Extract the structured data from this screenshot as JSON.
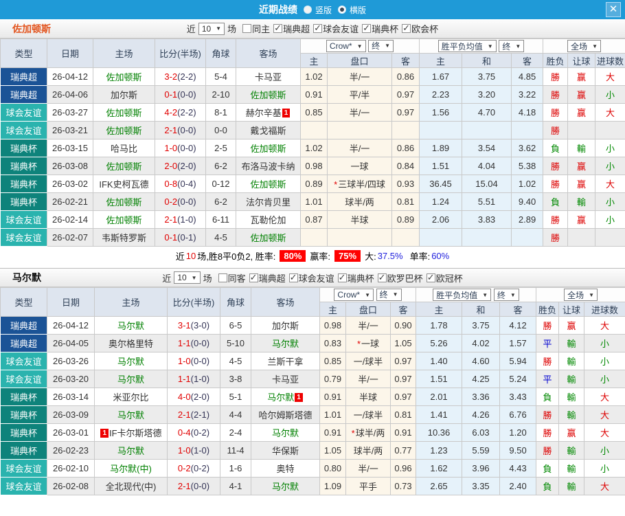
{
  "titlebar": {
    "title": "近期战绩",
    "radio_vertical": "竖版",
    "radio_horizontal": "横版",
    "close_label": "✕"
  },
  "table_header": {
    "type": "类型",
    "date": "日期",
    "home": "主场",
    "score": "比分(半场)",
    "corner": "角球",
    "away": "客场",
    "odds_home": "主",
    "odds_handicap": "盘口",
    "odds_away": "客",
    "mean_home": "主",
    "mean_draw": "和",
    "mean_away": "客",
    "result_wdl": "胜负",
    "result_handicap": "让球",
    "result_goals": "进球数",
    "dd_crow": "Crow*",
    "dd_final1": "终",
    "dd_mean": "胜平负均值",
    "dd_final2": "终",
    "dd_full": "全场"
  },
  "colors": {
    "league_super": "#1b5396",
    "league_friendly": "#2ab3ae",
    "league_cup": "#0e837b",
    "titlebar_blue": "#1f9ad7",
    "accent_red": "#e10000",
    "accent_green": "#008800",
    "accent_blue": "#0000d0"
  },
  "sections": [
    {
      "team": "佐加顿斯",
      "filter": {
        "near_label": "近",
        "games_value": "10",
        "games_label": "场",
        "checkboxes": [
          {
            "label": "同主",
            "checked": false
          },
          {
            "label": "瑞典超",
            "checked": true
          },
          {
            "label": "球会友谊",
            "checked": true
          },
          {
            "label": "瑞典杯",
            "checked": true
          },
          {
            "label": "欧会杯",
            "checked": true
          }
        ]
      },
      "rows": [
        {
          "type": "瑞典超",
          "type_color": "#1b5396",
          "date": "26-04-12",
          "home": "佐加顿斯",
          "home_green": true,
          "home_badge": "",
          "home_badge_pos": "",
          "score_full": "3-2",
          "score_half": "(2-2)",
          "corner": "5-4",
          "away": "卡马亚",
          "away_green": false,
          "away_badge": "",
          "odds_home": "1.02",
          "handicap": "半/一",
          "handicap_star": false,
          "odds_away": "0.86",
          "mean_home": "1.67",
          "mean_draw": "3.75",
          "mean_away": "4.85",
          "result_wdl": "勝",
          "result_wdl_color": "red",
          "result_handicap": "赢",
          "result_handicap_color": "red",
          "result_goals": "大",
          "result_goals_color": "red"
        },
        {
          "type": "瑞典超",
          "type_color": "#1b5396",
          "date": "26-04-06",
          "home": "加尔斯",
          "home_green": false,
          "home_badge": "",
          "home_badge_pos": "",
          "score_full": "0-1",
          "score_half": "(0-0)",
          "corner": "2-10",
          "away": "佐加顿斯",
          "away_green": true,
          "away_badge": "",
          "odds_home": "0.91",
          "handicap": "平/半",
          "handicap_star": false,
          "odds_away": "0.97",
          "mean_home": "2.23",
          "mean_draw": "3.20",
          "mean_away": "3.22",
          "result_wdl": "勝",
          "result_wdl_color": "red",
          "result_handicap": "赢",
          "result_handicap_color": "red",
          "result_goals": "小",
          "result_goals_color": "green"
        },
        {
          "type": "球会友谊",
          "type_color": "#2ab3ae",
          "date": "26-03-27",
          "home": "佐加顿斯",
          "home_green": true,
          "home_badge": "",
          "home_badge_pos": "",
          "score_full": "4-2",
          "score_half": "(2-2)",
          "corner": "8-1",
          "away": "赫尔辛基",
          "away_green": false,
          "away_badge": "1",
          "odds_home": "0.85",
          "handicap": "半/一",
          "handicap_star": false,
          "odds_away": "0.97",
          "mean_home": "1.56",
          "mean_draw": "4.70",
          "mean_away": "4.18",
          "result_wdl": "勝",
          "result_wdl_color": "red",
          "result_handicap": "赢",
          "result_handicap_color": "red",
          "result_goals": "大",
          "result_goals_color": "red"
        },
        {
          "type": "球会友谊",
          "type_color": "#2ab3ae",
          "date": "26-03-21",
          "home": "佐加顿斯",
          "home_green": true,
          "home_badge": "",
          "home_badge_pos": "",
          "score_full": "2-1",
          "score_half": "(0-0)",
          "corner": "0-0",
          "away": "戴戈福斯",
          "away_green": false,
          "away_badge": "",
          "odds_home": "",
          "handicap": "",
          "handicap_star": false,
          "odds_away": "",
          "mean_home": "",
          "mean_draw": "",
          "mean_away": "",
          "result_wdl": "勝",
          "result_wdl_color": "red",
          "result_handicap": "",
          "result_handicap_color": "red",
          "result_goals": "",
          "result_goals_color": "red"
        },
        {
          "type": "瑞典杯",
          "type_color": "#0e837b",
          "date": "26-03-15",
          "home": "哈马比",
          "home_green": false,
          "home_badge": "",
          "home_badge_pos": "",
          "score_full": "1-0",
          "score_half": "(0-0)",
          "corner": "2-5",
          "away": "佐加顿斯",
          "away_green": true,
          "away_badge": "",
          "odds_home": "1.02",
          "handicap": "半/一",
          "handicap_star": false,
          "odds_away": "0.86",
          "mean_home": "1.89",
          "mean_draw": "3.54",
          "mean_away": "3.62",
          "result_wdl": "負",
          "result_wdl_color": "green",
          "result_handicap": "輸",
          "result_handicap_color": "green",
          "result_goals": "小",
          "result_goals_color": "green"
        },
        {
          "type": "瑞典杯",
          "type_color": "#0e837b",
          "date": "26-03-08",
          "home": "佐加顿斯",
          "home_green": true,
          "home_badge": "",
          "home_badge_pos": "",
          "score_full": "2-0",
          "score_half": "(2-0)",
          "corner": "6-2",
          "away": "布洛马波卡纳",
          "away_green": false,
          "away_badge": "",
          "odds_home": "0.98",
          "handicap": "一球",
          "handicap_star": false,
          "odds_away": "0.84",
          "mean_home": "1.51",
          "mean_draw": "4.04",
          "mean_away": "5.38",
          "result_wdl": "勝",
          "result_wdl_color": "red",
          "result_handicap": "赢",
          "result_handicap_color": "red",
          "result_goals": "小",
          "result_goals_color": "green"
        },
        {
          "type": "瑞典杯",
          "type_color": "#0e837b",
          "date": "26-03-02",
          "home": "IFK史柯瓦德",
          "home_green": false,
          "home_badge": "",
          "home_badge_pos": "",
          "score_full": "0-8",
          "score_half": "(0-4)",
          "corner": "0-12",
          "away": "佐加顿斯",
          "away_green": true,
          "away_badge": "",
          "odds_home": "0.89",
          "handicap": "三球半/四球",
          "handicap_star": true,
          "odds_away": "0.93",
          "mean_home": "36.45",
          "mean_draw": "15.04",
          "mean_away": "1.02",
          "result_wdl": "勝",
          "result_wdl_color": "red",
          "result_handicap": "赢",
          "result_handicap_color": "red",
          "result_goals": "大",
          "result_goals_color": "red"
        },
        {
          "type": "瑞典杯",
          "type_color": "#0e837b",
          "date": "26-02-21",
          "home": "佐加顿斯",
          "home_green": true,
          "home_badge": "",
          "home_badge_pos": "",
          "score_full": "0-2",
          "score_half": "(0-0)",
          "corner": "6-2",
          "away": "法尔肯贝里",
          "away_green": false,
          "away_badge": "",
          "odds_home": "1.01",
          "handicap": "球半/两",
          "handicap_star": false,
          "odds_away": "0.81",
          "mean_home": "1.24",
          "mean_draw": "5.51",
          "mean_away": "9.40",
          "result_wdl": "負",
          "result_wdl_color": "green",
          "result_handicap": "輸",
          "result_handicap_color": "green",
          "result_goals": "小",
          "result_goals_color": "green"
        },
        {
          "type": "球会友谊",
          "type_color": "#2ab3ae",
          "date": "26-02-14",
          "home": "佐加顿斯",
          "home_green": true,
          "home_badge": "",
          "home_badge_pos": "",
          "score_full": "2-1",
          "score_half": "(1-0)",
          "corner": "6-11",
          "away": "瓦勒伦加",
          "away_green": false,
          "away_badge": "",
          "odds_home": "0.87",
          "handicap": "半球",
          "handicap_star": false,
          "odds_away": "0.89",
          "mean_home": "2.06",
          "mean_draw": "3.83",
          "mean_away": "2.89",
          "result_wdl": "勝",
          "result_wdl_color": "red",
          "result_handicap": "赢",
          "result_handicap_color": "red",
          "result_goals": "小",
          "result_goals_color": "green"
        },
        {
          "type": "球会友谊",
          "type_color": "#2ab3ae",
          "date": "26-02-07",
          "home": "韦斯特罗斯",
          "home_green": false,
          "home_badge": "",
          "home_badge_pos": "",
          "score_full": "0-1",
          "score_half": "(0-1)",
          "corner": "4-5",
          "away": "佐加顿斯",
          "away_green": true,
          "away_badge": "",
          "odds_home": "",
          "handicap": "",
          "handicap_star": false,
          "odds_away": "",
          "mean_home": "",
          "mean_draw": "",
          "mean_away": "",
          "result_wdl": "勝",
          "result_wdl_color": "red",
          "result_handicap": "",
          "result_handicap_color": "red",
          "result_goals": "",
          "result_goals_color": "red"
        }
      ],
      "summary": {
        "part1": "近",
        "count": "10",
        "part2": "场,胜8平0负2, 胜率:",
        "win_rate": "80%",
        "label_win2": "赢率:",
        "win_rate2": "75%",
        "label_big": "大:",
        "big_rate": "37.5%",
        "label_single": "单率:",
        "single_rate": "60%"
      }
    },
    {
      "team": "马尔默",
      "filter": {
        "near_label": "近",
        "games_value": "10",
        "games_label": "场",
        "checkboxes": [
          {
            "label": "同客",
            "checked": false
          },
          {
            "label": "瑞典超",
            "checked": true
          },
          {
            "label": "球会友谊",
            "checked": true
          },
          {
            "label": "瑞典杯",
            "checked": true
          },
          {
            "label": "欧罗巴杯",
            "checked": true
          },
          {
            "label": "欧冠杯",
            "checked": true
          }
        ]
      },
      "rows": [
        {
          "type": "瑞典超",
          "type_color": "#1b5396",
          "date": "26-04-12",
          "home": "马尔默",
          "home_green": true,
          "home_badge": "",
          "home_badge_pos": "",
          "score_full": "3-1",
          "score_half": "(3-0)",
          "corner": "6-5",
          "away": "加尔斯",
          "away_green": false,
          "away_badge": "",
          "odds_home": "0.98",
          "handicap": "半/一",
          "handicap_star": false,
          "odds_away": "0.90",
          "mean_home": "1.78",
          "mean_draw": "3.75",
          "mean_away": "4.12",
          "result_wdl": "勝",
          "result_wdl_color": "red",
          "result_handicap": "赢",
          "result_handicap_color": "red",
          "result_goals": "大",
          "result_goals_color": "red"
        },
        {
          "type": "瑞典超",
          "type_color": "#1b5396",
          "date": "26-04-05",
          "home": "奥尔格里特",
          "home_green": false,
          "home_badge": "",
          "home_badge_pos": "",
          "score_full": "1-1",
          "score_half": "(0-0)",
          "corner": "5-10",
          "away": "马尔默",
          "away_green": true,
          "away_badge": "",
          "odds_home": "0.83",
          "handicap": "一球",
          "handicap_star": true,
          "odds_away": "1.05",
          "mean_home": "5.26",
          "mean_draw": "4.02",
          "mean_away": "1.57",
          "result_wdl": "平",
          "result_wdl_color": "blue",
          "result_handicap": "輸",
          "result_handicap_color": "green",
          "result_goals": "小",
          "result_goals_color": "green"
        },
        {
          "type": "球会友谊",
          "type_color": "#2ab3ae",
          "date": "26-03-26",
          "home": "马尔默",
          "home_green": true,
          "home_badge": "",
          "home_badge_pos": "",
          "score_full": "1-0",
          "score_half": "(0-0)",
          "corner": "4-5",
          "away": "兰斯干拿",
          "away_green": false,
          "away_badge": "",
          "odds_home": "0.85",
          "handicap": "一/球半",
          "handicap_star": false,
          "odds_away": "0.97",
          "mean_home": "1.40",
          "mean_draw": "4.60",
          "mean_away": "5.94",
          "result_wdl": "勝",
          "result_wdl_color": "red",
          "result_handicap": "輸",
          "result_handicap_color": "green",
          "result_goals": "小",
          "result_goals_color": "green"
        },
        {
          "type": "球会友谊",
          "type_color": "#2ab3ae",
          "date": "26-03-20",
          "home": "马尔默",
          "home_green": true,
          "home_badge": "",
          "home_badge_pos": "",
          "score_full": "1-1",
          "score_half": "(1-0)",
          "corner": "3-8",
          "away": "卡马亚",
          "away_green": false,
          "away_badge": "",
          "odds_home": "0.79",
          "handicap": "半/一",
          "handicap_star": false,
          "odds_away": "0.97",
          "mean_home": "1.51",
          "mean_draw": "4.25",
          "mean_away": "5.24",
          "result_wdl": "平",
          "result_wdl_color": "blue",
          "result_handicap": "輸",
          "result_handicap_color": "green",
          "result_goals": "小",
          "result_goals_color": "green"
        },
        {
          "type": "瑞典杯",
          "type_color": "#0e837b",
          "date": "26-03-14",
          "home": "米亚尔比",
          "home_green": false,
          "home_badge": "",
          "home_badge_pos": "",
          "score_full": "4-0",
          "score_half": "(2-0)",
          "corner": "5-1",
          "away": "马尔默",
          "away_green": true,
          "away_badge": "1",
          "odds_home": "0.91",
          "handicap": "半球",
          "handicap_star": false,
          "odds_away": "0.97",
          "mean_home": "2.01",
          "mean_draw": "3.36",
          "mean_away": "3.43",
          "result_wdl": "負",
          "result_wdl_color": "green",
          "result_handicap": "輸",
          "result_handicap_color": "green",
          "result_goals": "大",
          "result_goals_color": "red"
        },
        {
          "type": "瑞典杯",
          "type_color": "#0e837b",
          "date": "26-03-09",
          "home": "马尔默",
          "home_green": true,
          "home_badge": "",
          "home_badge_pos": "",
          "score_full": "2-1",
          "score_half": "(2-1)",
          "corner": "4-4",
          "away": "哈尔姆斯塔德",
          "away_green": false,
          "away_badge": "",
          "odds_home": "1.01",
          "handicap": "一/球半",
          "handicap_star": false,
          "odds_away": "0.81",
          "mean_home": "1.41",
          "mean_draw": "4.26",
          "mean_away": "6.76",
          "result_wdl": "勝",
          "result_wdl_color": "red",
          "result_handicap": "輸",
          "result_handicap_color": "green",
          "result_goals": "大",
          "result_goals_color": "red"
        },
        {
          "type": "瑞典杯",
          "type_color": "#0e837b",
          "date": "26-03-01",
          "home": "IF卡尔斯塔德",
          "home_green": false,
          "home_badge": "1",
          "home_badge_pos": "before",
          "score_full": "0-4",
          "score_half": "(0-2)",
          "corner": "2-4",
          "away": "马尔默",
          "away_green": true,
          "away_badge": "",
          "odds_home": "0.91",
          "handicap": "球半/两",
          "handicap_star": true,
          "odds_away": "0.91",
          "mean_home": "10.36",
          "mean_draw": "6.03",
          "mean_away": "1.20",
          "result_wdl": "勝",
          "result_wdl_color": "red",
          "result_handicap": "赢",
          "result_handicap_color": "red",
          "result_goals": "大",
          "result_goals_color": "red"
        },
        {
          "type": "瑞典杯",
          "type_color": "#0e837b",
          "date": "26-02-23",
          "home": "马尔默",
          "home_green": true,
          "home_badge": "",
          "home_badge_pos": "",
          "score_full": "1-0",
          "score_half": "(1-0)",
          "corner": "11-4",
          "away": "华保斯",
          "away_green": false,
          "away_badge": "",
          "odds_home": "1.05",
          "handicap": "球半/两",
          "handicap_star": false,
          "odds_away": "0.77",
          "mean_home": "1.23",
          "mean_draw": "5.59",
          "mean_away": "9.50",
          "result_wdl": "勝",
          "result_wdl_color": "red",
          "result_handicap": "輸",
          "result_handicap_color": "green",
          "result_goals": "小",
          "result_goals_color": "green"
        },
        {
          "type": "球会友谊",
          "type_color": "#2ab3ae",
          "date": "26-02-10",
          "home": "马尔默(中)",
          "home_green": true,
          "home_badge": "",
          "home_badge_pos": "",
          "score_full": "0-2",
          "score_half": "(0-2)",
          "corner": "1-6",
          "away": "奥特",
          "away_green": false,
          "away_badge": "",
          "odds_home": "0.80",
          "handicap": "半/一",
          "handicap_star": false,
          "odds_away": "0.96",
          "mean_home": "1.62",
          "mean_draw": "3.96",
          "mean_away": "4.43",
          "result_wdl": "負",
          "result_wdl_color": "green",
          "result_handicap": "輸",
          "result_handicap_color": "green",
          "result_goals": "小",
          "result_goals_color": "green"
        },
        {
          "type": "球会友谊",
          "type_color": "#2ab3ae",
          "date": "26-02-08",
          "home": "全北现代(中)",
          "home_green": false,
          "home_badge": "",
          "home_badge_pos": "",
          "score_full": "2-1",
          "score_half": "(0-0)",
          "corner": "4-1",
          "away": "马尔默",
          "away_green": true,
          "away_badge": "",
          "odds_home": "1.09",
          "handicap": "平手",
          "handicap_star": false,
          "odds_away": "0.73",
          "mean_home": "2.65",
          "mean_draw": "3.35",
          "mean_away": "2.40",
          "result_wdl": "負",
          "result_wdl_color": "green",
          "result_handicap": "輸",
          "result_handicap_color": "green",
          "result_goals": "大",
          "result_goals_color": "red"
        }
      ],
      "summary": null
    }
  ]
}
